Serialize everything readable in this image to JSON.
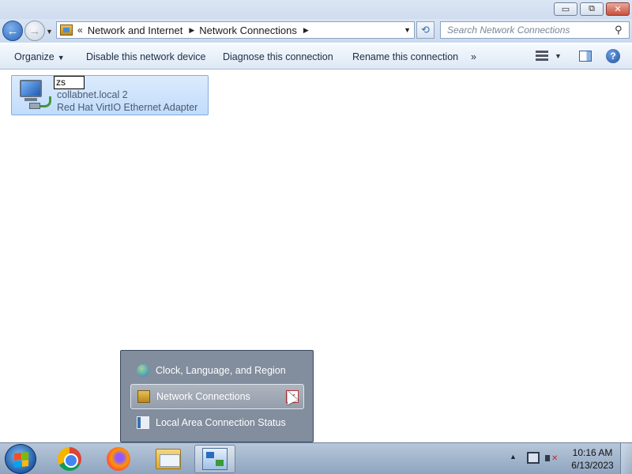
{
  "window": {
    "minimize_glyph": "▭",
    "maximize_glyph": "⧉",
    "close_glyph": "✕"
  },
  "address": {
    "overflow": "«",
    "crumbs": [
      "Network and Internet",
      "Network Connections"
    ],
    "refresh_glyph": "⟲",
    "search_placeholder": "Search Network Connections",
    "search_glyph": "⚲"
  },
  "toolbar": {
    "organize": "Organize",
    "disable": "Disable this network device",
    "diagnose": "Diagnose this connection",
    "rename": "Rename this connection",
    "more": "»",
    "help_glyph": "?"
  },
  "connection": {
    "name_edit": "zs",
    "network": "collabnet.local  2",
    "adapter": "Red Hat VirtIO Ethernet Adapter"
  },
  "jumplist": {
    "items": [
      {
        "label": "Clock, Language, and Region",
        "icon": "globe-clock-icon"
      },
      {
        "label": "Network Connections",
        "icon": "network-connections-icon"
      },
      {
        "label": "Local Area Connection Status",
        "icon": "lac-status-icon"
      }
    ],
    "unpin_glyph": "✕"
  },
  "taskbar": {
    "apps": [
      "start-orb",
      "chrome-icon",
      "firefox-icon",
      "explorer-icon",
      "network-connections-icon"
    ],
    "clock_time": "10:16 AM",
    "clock_date": "6/13/2023"
  }
}
